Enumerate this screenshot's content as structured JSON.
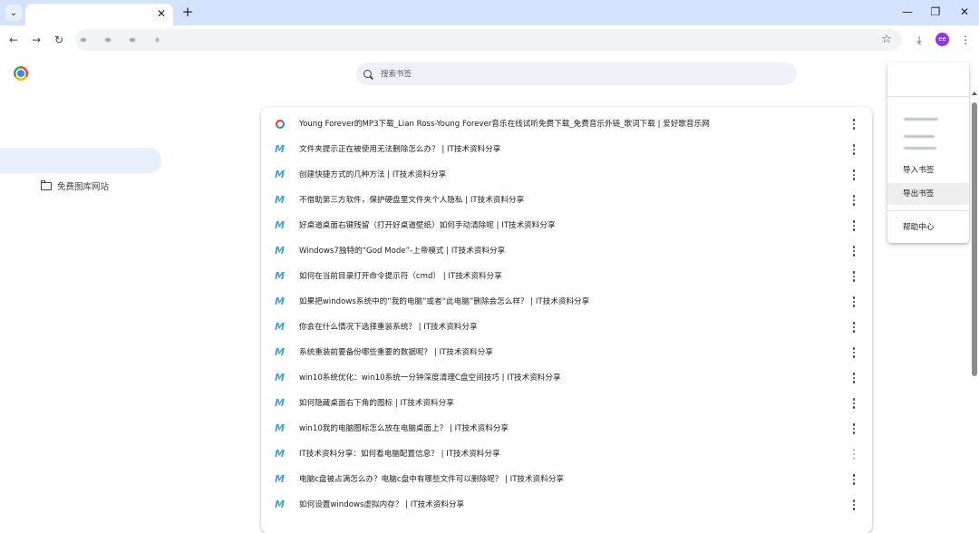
{
  "tabstrip": {
    "tab_search_icon": "chevron-down-icon",
    "close_glyph": "✕",
    "new_tab_glyph": "+",
    "minimize_glyph": "—",
    "maximize_glyph": "❐",
    "window_close_glyph": "✕"
  },
  "toolbar": {
    "back_glyph": "←",
    "forward_glyph": "→",
    "reload_glyph": "↻",
    "star_glyph": "☆",
    "download_glyph": "⤓",
    "menu_glyph": "⋮",
    "profile_initials": "ee",
    "profile_color": "#9334e6"
  },
  "sidebar": {
    "folder_label": "免费图库网站"
  },
  "search": {
    "placeholder": "搜索书签"
  },
  "bookmarks": [
    {
      "title": "Young Forever的MP3下载_Lian Ross-Young Forever音乐在线试听免费下载_免费音乐外链_歌词下载 | 爱好歌音乐网",
      "favicon": "music-favicon"
    },
    {
      "title": "文件夹提示正在被使用无法删除怎么办？ | IT技术资料分享",
      "favicon": "it-favicon"
    },
    {
      "title": "创建快捷方式的几种方法 | IT技术资料分享",
      "favicon": "it-favicon"
    },
    {
      "title": "不借助第三方软件，保护硬盘里文件夹个人隐私 | IT技术资料分享",
      "favicon": "it-favicon"
    },
    {
      "title": "好桌道桌面右键残留（打开好桌道壁纸）如何手动清除呢 | IT技术资料分享",
      "favicon": "it-favicon"
    },
    {
      "title": "Windows7独特的“God Mode”-上帝模式 | IT技术资料分享",
      "favicon": "it-favicon"
    },
    {
      "title": "如何在当前目录打开命令提示符（cmd） | IT技术资料分享",
      "favicon": "it-favicon"
    },
    {
      "title": "如果把windows系统中的“我的电脑”或者“此电脑”删除会怎么样？ | IT技术资料分享",
      "favicon": "it-favicon"
    },
    {
      "title": "你会在什么情况下选择重装系统？ | IT技术资料分享",
      "favicon": "it-favicon"
    },
    {
      "title": "系统重装前要备份哪些重要的数据呢？ | IT技术资料分享",
      "favicon": "it-favicon"
    },
    {
      "title": "win10系统优化：win10系统一分钟深度清理C盘空间技巧 | IT技术资料分享",
      "favicon": "it-favicon"
    },
    {
      "title": "如何隐藏桌面右下角的图标 | IT技术资料分享",
      "favicon": "it-favicon"
    },
    {
      "title": "win10我的电脑图标怎么放在电脑桌面上？ | IT技术资料分享",
      "favicon": "it-favicon"
    },
    {
      "title": "IT技术资料分享：如何看电脑配置信息？ | IT技术资料分享",
      "favicon": "it-favicon"
    },
    {
      "title": "电脑c盘被占满怎么办？电脑c盘中有哪些文件可以删除呢？ | IT技术资料分享",
      "favicon": "it-favicon"
    },
    {
      "title": "如何设置windows虚拟内存？ | IT技术资料分享",
      "favicon": "it-favicon"
    }
  ],
  "organize_menu": {
    "import_label": "导入书签",
    "export_label": "导出书签",
    "help_label": "帮助中心"
  },
  "colors": {
    "tabstrip_bg": "#d3e3fd",
    "selected_bg": "#e8f0fe",
    "it_favicon": "#3aa7d4"
  }
}
